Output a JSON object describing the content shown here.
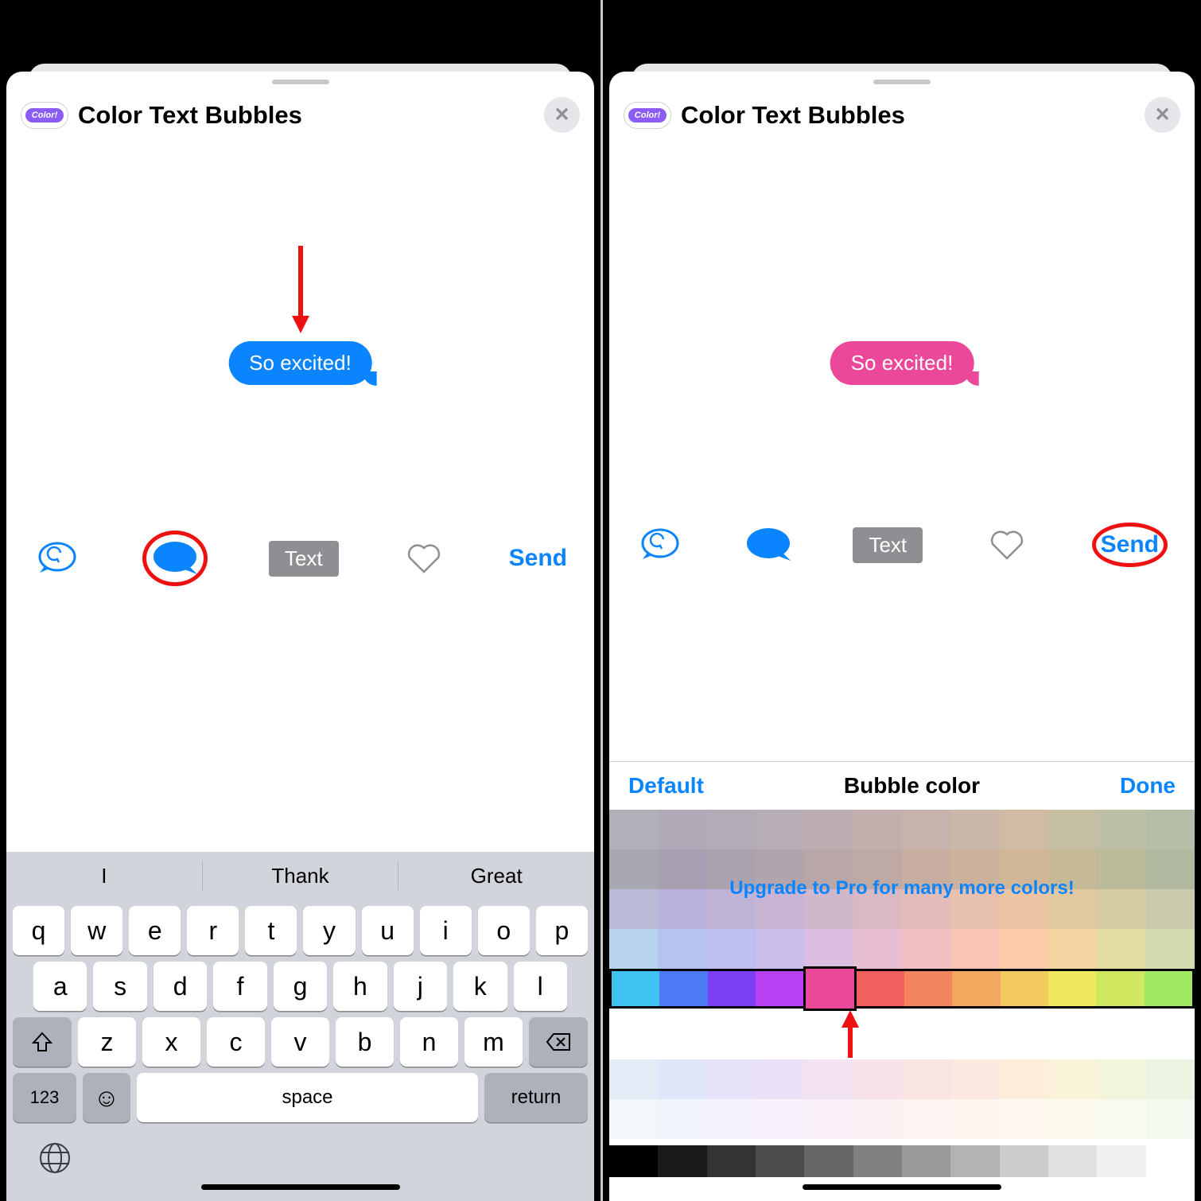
{
  "app": {
    "title": "Color Text Bubbles",
    "icon_label": "Color!",
    "close_glyph": "✕"
  },
  "left": {
    "bubble": {
      "text": "So excited!",
      "color": "#0a84ff"
    },
    "toolbar": {
      "text_chip": "Text",
      "send": "Send"
    },
    "annotation": {
      "arrow_target": "message-bubble",
      "ring_target": "bubble-color-button"
    },
    "keyboard": {
      "suggestions": [
        "I",
        "Thank",
        "Great"
      ],
      "rows": [
        [
          "q",
          "w",
          "e",
          "r",
          "t",
          "y",
          "u",
          "i",
          "o",
          "p"
        ],
        [
          "a",
          "s",
          "d",
          "f",
          "g",
          "h",
          "j",
          "k",
          "l"
        ],
        [
          "z",
          "x",
          "c",
          "v",
          "b",
          "n",
          "m"
        ]
      ],
      "numbers_key": "123",
      "space_key": "space",
      "return_key": "return"
    }
  },
  "right": {
    "bubble": {
      "text": "So excited!",
      "color": "#ec4899"
    },
    "toolbar": {
      "text_chip": "Text",
      "send": "Send"
    },
    "annotation": {
      "ring_target": "send-button",
      "arrow_target": "selected-color"
    },
    "picker": {
      "default_label": "Default",
      "title": "Bubble color",
      "done_label": "Done",
      "upsell": "Upgrade to Pro for many more colors!",
      "muted_rows": [
        [
          "#b0b0b8",
          "#b0aab8",
          "#b3acb6",
          "#b7adb4",
          "#bcaeb0",
          "#c2b0ae",
          "#c7b3ab",
          "#cbb7a8",
          "#cfbba6",
          "#c6bea3",
          "#bdc0a4",
          "#b4bea9"
        ],
        [
          "#a8a8b2",
          "#a6a0b2",
          "#aba2b0",
          "#b1a4ad",
          "#b8a6a8",
          "#bfa9a4",
          "#c6ada0",
          "#ccb19c",
          "#d2b698",
          "#c6b995",
          "#bbbb99",
          "#b0b9a0"
        ],
        [
          "#b9bbd6",
          "#b9b2da",
          "#c0b3d8",
          "#c8b5d3",
          "#d1b7cb",
          "#dab9c2",
          "#e1bcb8",
          "#e8c0ae",
          "#eec5a4",
          "#e2c99f",
          "#d6cca4",
          "#c9caae"
        ],
        [
          "#b8d4ee",
          "#b4c3f2",
          "#bfc0f0",
          "#ccbeea",
          "#dabde0",
          "#e8bed2",
          "#f2c0c3",
          "#f8c5b5",
          "#fccca8",
          "#f1d4a0",
          "#e3dca2",
          "#d2dcb0"
        ]
      ],
      "active_row": [
        "#3fc1f2",
        "#4f7af7",
        "#7b3ff2",
        "#b83ff2",
        "#ec4899",
        "#f25f5f",
        "#f2855f",
        "#f2a85f",
        "#f2ca5f",
        "#f2e85f",
        "#cfe85f",
        "#9fe85f"
      ],
      "selected_index": 4,
      "pastel_rows": [
        [
          "#e3edf8",
          "#e2e6fb",
          "#e6e3fa",
          "#ece2f7",
          "#f3e2f1",
          "#f8e2e9",
          "#fae4e2",
          "#fce8de",
          "#fdeedc",
          "#faf3da",
          "#f3f5db",
          "#eaf4e1"
        ],
        [
          "#f2f7fc",
          "#f2f4fd",
          "#f4f3fd",
          "#f7f2fb",
          "#faf2f8",
          "#fcf2f4",
          "#fdf3f1",
          "#fdf5ef",
          "#fef8ee",
          "#fcfaed",
          "#f9fbee",
          "#f5faf1"
        ]
      ],
      "grayscale_row": [
        "#000000",
        "#1a1a1a",
        "#333333",
        "#4d4d4d",
        "#666666",
        "#808080",
        "#999999",
        "#b3b3b3",
        "#cccccc",
        "#e0e0e0",
        "#f0f0f0",
        "#ffffff"
      ]
    }
  }
}
